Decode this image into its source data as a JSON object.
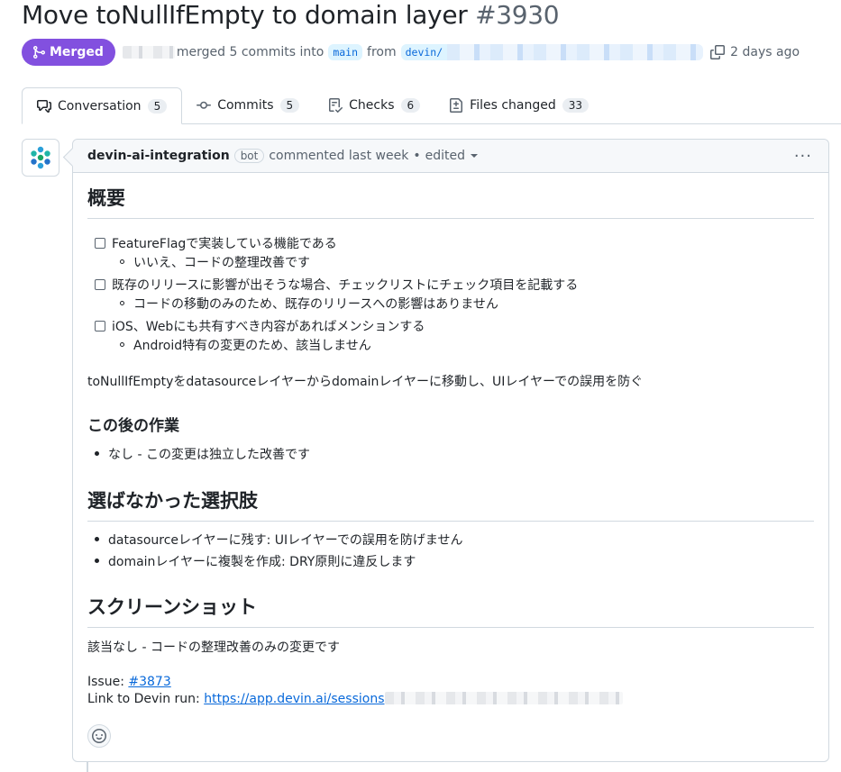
{
  "pr": {
    "title": "Move toNullIfEmpty to domain layer",
    "number": "#3930",
    "state": "Merged",
    "meta_text": "merged 5 commits into",
    "base_branch": "main",
    "from_text": "from",
    "head_branch": "devin/",
    "time": "2 days ago",
    "accent": "#8250df"
  },
  "tabs": [
    {
      "label": "Conversation",
      "count": "5",
      "icon": "comment-icon"
    },
    {
      "label": "Commits",
      "count": "5",
      "icon": "commit-icon"
    },
    {
      "label": "Checks",
      "count": "6",
      "icon": "checklist-icon"
    },
    {
      "label": "Files changed",
      "count": "33",
      "icon": "file-diff-icon"
    }
  ],
  "comment": {
    "author": "devin-ai-integration",
    "bot_label": "bot",
    "action": "commented last week",
    "separator": "•",
    "edited": "edited",
    "menu": "···",
    "sections": {
      "overview": "概要",
      "checklist": [
        {
          "text": "FeatureFlagで実装している機能である",
          "sub": "いいえ、コードの整理改善です"
        },
        {
          "text": "既存のリリースに影響が出そうな場合、チェックリストにチェック項目を記載する",
          "sub": "コードの移動のみのため、既存のリリースへの影響はありません"
        },
        {
          "text": "iOS、Webにも共有すべき内容があればメンションする",
          "sub": "Android特有の変更のため、該当しません"
        }
      ],
      "summary": "toNullIfEmptyをdatasourceレイヤーからdomainレイヤーに移動し、UIレイヤーでの誤用を防ぐ",
      "next_title": "この後の作業",
      "next_items": [
        "なし - この変更は独立した改善です"
      ],
      "alternatives_title": "選ばなかった選択肢",
      "alternatives": [
        "datasourceレイヤーに残す: UIレイヤーでの誤用を防げません",
        "domainレイヤーに複製を作成: DRY原則に違反します"
      ],
      "screenshot_title": "スクリーンショット",
      "screenshot_text": "該当なし - コードの整理改善のみの変更です",
      "issue_label": "Issue:",
      "issue_link": "#3873",
      "devin_label": "Link to Devin run:",
      "devin_link": "https://app.devin.ai/sessions"
    }
  }
}
